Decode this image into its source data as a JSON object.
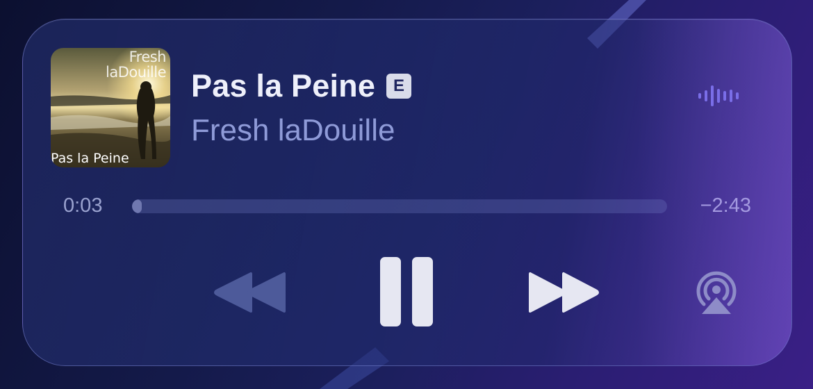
{
  "now_playing": {
    "title": "Pas la Peine",
    "explicit_badge": "E",
    "artist": "Fresh laDouille",
    "artwork": {
      "top_text": "Fresh laDouille",
      "bottom_text": "Pas la Peine"
    }
  },
  "progress": {
    "elapsed": "0:03",
    "remaining": "−2:43",
    "fraction": 0.018
  },
  "controls": {
    "rewind_icon": "rewind-icon",
    "pause_icon": "pause-icon",
    "forward_icon": "fast-forward-icon",
    "airplay_icon": "airplay-icon",
    "waveform_icon": "waveform-icon"
  },
  "colors": {
    "accent": "#8b7bf0",
    "title": "#eef0fa",
    "artist": "#8f9bd8"
  }
}
